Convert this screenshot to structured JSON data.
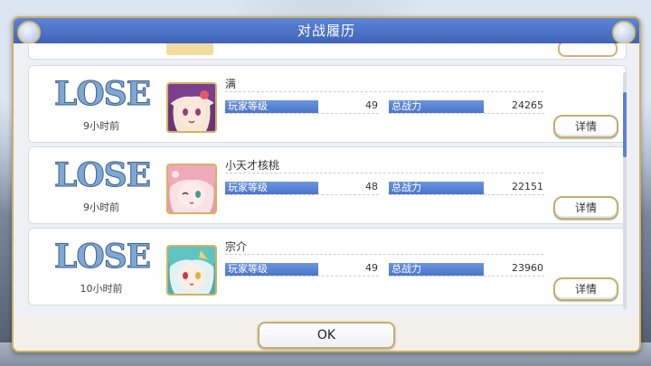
{
  "dialog": {
    "title": "对战履历",
    "ok_label": "OK"
  },
  "colors": {
    "title_bar": "#4a71c6",
    "result_text": "#7fa7d3",
    "stat_label_bg": "#5b84d4",
    "button_border": "#c4ad6d"
  },
  "records": [
    {
      "result": "LOSE",
      "time": "9小时前",
      "player_name": "满",
      "level_label": "玩家等级",
      "level": "49",
      "power_label": "总战力",
      "power": "24265",
      "detail_label": "详情"
    },
    {
      "result": "LOSE",
      "time": "9小时前",
      "player_name": "小天才核桃",
      "level_label": "玩家等级",
      "level": "48",
      "power_label": "总战力",
      "power": "22151",
      "detail_label": "详情"
    },
    {
      "result": "LOSE",
      "time": "10小时前",
      "player_name": "宗介",
      "level_label": "玩家等级",
      "level": "49",
      "power_label": "总战力",
      "power": "23960",
      "detail_label": "详情"
    }
  ]
}
